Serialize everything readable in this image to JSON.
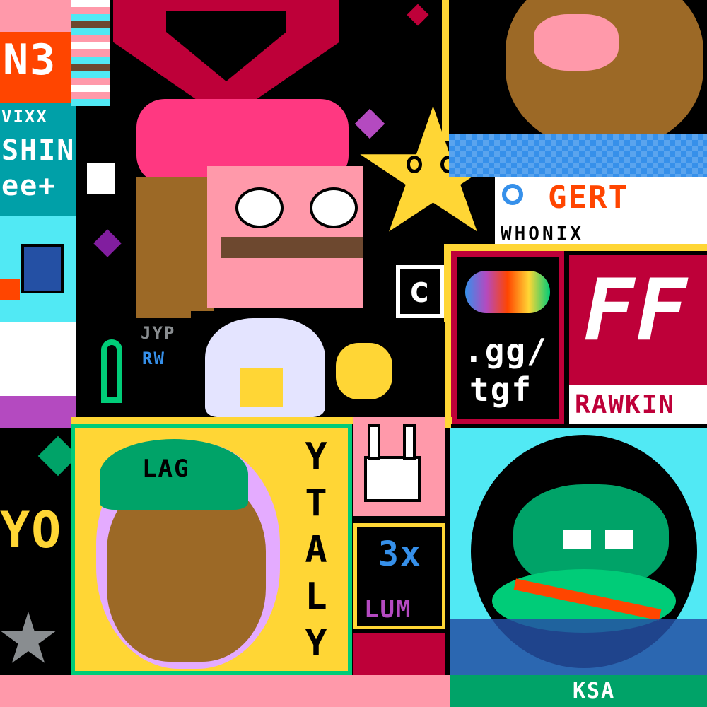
{
  "canvas": {
    "background": "#000000"
  },
  "texts": {
    "top_left_word": "N3",
    "vixx": "VIXX",
    "shin": "SHIN",
    "ee": "ee+",
    "jyp": "JYP",
    "rw": "RW",
    "yo": "YO",
    "lag": "LAG",
    "ytaly": "YTALY",
    "lum": "LUM",
    "lum_small": "3x",
    "gert": "GERT",
    "whonix": "WHONIX",
    "ggl": ".gg/",
    "tgf": "tgf",
    "ff": "FF",
    "rawkin": "RAWKIN",
    "c_letter": "c",
    "ksa": "KSA"
  },
  "colors": {
    "crimson": "#be0039",
    "pink": "#ff99aa",
    "hot_pink": "#ff3881",
    "gold": "#ffd635",
    "orange": "#ff4500",
    "green": "#00a368",
    "mint": "#00cc78",
    "cyan": "#51e9f4",
    "blue": "#3690ea",
    "navy": "#2450a4",
    "purple": "#811e9f",
    "lavender": "#b44ac0",
    "brown": "#9c6926",
    "dark_brown": "#6d482f",
    "white": "#ffffff",
    "gray": "#898d90",
    "black": "#000000"
  },
  "icons": [
    "superman-logo-icon",
    "pink-bow-frog-icon",
    "star-face-icon",
    "bearded-man-face-icon",
    "white-haired-anime-face-icon",
    "man-with-green-cap-icon",
    "white-bunny-icon",
    "green-frog-face-icon",
    "colorful-ring-logo-icon",
    "heart-icon"
  ]
}
